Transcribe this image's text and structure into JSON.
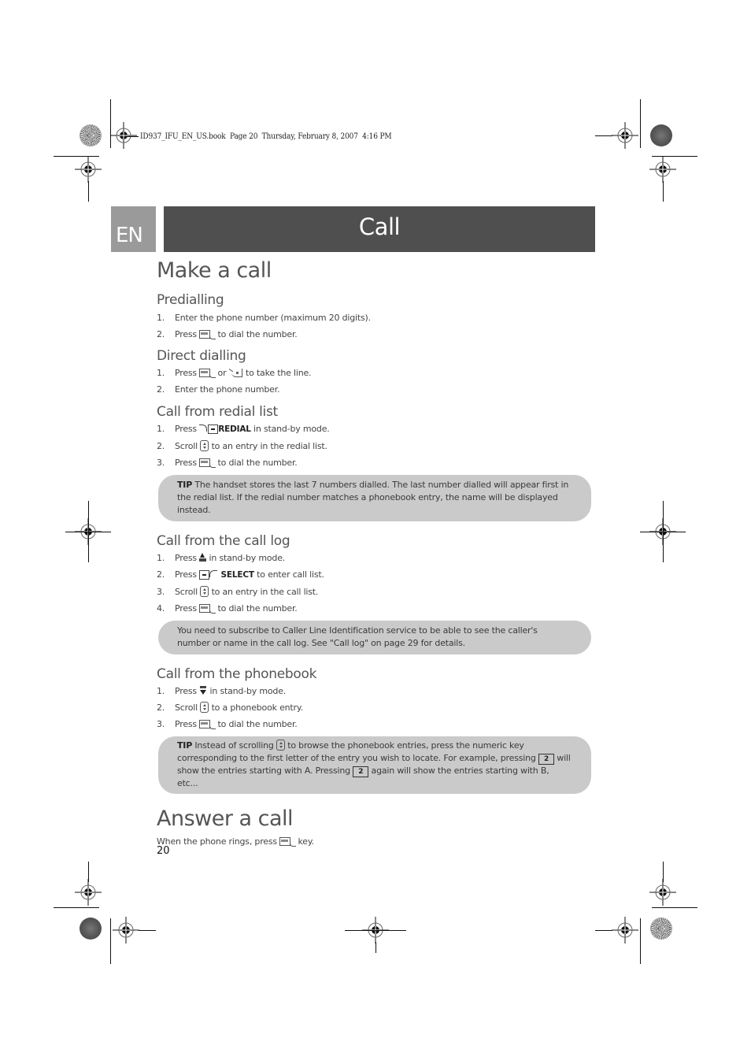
{
  "slug": "ID937_IFU_EN_US.book  Page 20  Thursday, February 8, 2007  4:16 PM",
  "header": {
    "language_tab": "EN",
    "chapter_title": "Call"
  },
  "sections": {
    "make_a_call": {
      "title": "Make a call",
      "predialling": {
        "title": "Predialling",
        "steps": [
          {
            "num": "1.",
            "text": "Enter the phone number (maximum 20 digits)."
          },
          {
            "num": "2.",
            "pre": "Press",
            "icon": "talk-key-icon",
            "post": "to dial the number."
          }
        ]
      },
      "direct_dialling": {
        "title": "Direct dialling",
        "steps": [
          {
            "num": "1.",
            "pre": "Press",
            "icon": "talk-key-icon",
            "mid": "or",
            "icon2": "speaker-key-icon",
            "post": "to take the line."
          },
          {
            "num": "2.",
            "text": "Enter the phone number."
          }
        ]
      },
      "redial": {
        "title": "Call from redial list",
        "steps": [
          {
            "num": "1.",
            "pre": "Press",
            "icon": "right-softkey-icon",
            "key": "REDIAL",
            "post": "in stand-by mode."
          },
          {
            "num": "2.",
            "pre": "Scroll",
            "icon": "scroll-key-icon",
            "post": "to an entry in the redial list."
          },
          {
            "num": "3.",
            "pre": "Press",
            "icon": "talk-key-icon",
            "post": "to dial the number."
          }
        ],
        "tip": {
          "label": "TIP",
          "text": "The handset stores the last 7 numbers dialled. The last number dialled will appear first in the redial list. If the redial number matches a phonebook entry, the name will be displayed instead."
        }
      },
      "call_log": {
        "title": "Call from the call log",
        "steps": [
          {
            "num": "1.",
            "pre": "Press",
            "icon": "call-log-up-key-icon",
            "post": "in stand-by mode."
          },
          {
            "num": "2.",
            "pre": "Press",
            "icon": "left-softkey-icon",
            "key": "SELECT",
            "post": "to enter call list."
          },
          {
            "num": "3.",
            "pre": "Scroll",
            "icon": "scroll-key-icon",
            "post": "to an entry in the call list."
          },
          {
            "num": "4.",
            "pre": "Press",
            "icon": "talk-key-icon",
            "post": "to dial the number."
          }
        ],
        "note": "You need to subscribe to Caller Line Identification service to be able to see the caller's number or name in the call log. See \"Call log\" on page 29 for details."
      },
      "phonebook": {
        "title": "Call from the phonebook",
        "steps": [
          {
            "num": "1.",
            "pre": "Press",
            "icon": "phonebook-down-key-icon",
            "post": "in stand-by mode."
          },
          {
            "num": "2.",
            "pre": "Scroll",
            "icon": "scroll-key-icon",
            "post": "to a phonebook entry."
          },
          {
            "num": "3.",
            "pre": "Press",
            "icon": "talk-key-icon",
            "post": "to dial the number."
          }
        ],
        "tip": {
          "label": "TIP",
          "part1": "Instead of scrolling",
          "part2": "to browse the phonebook entries, press the numeric key corresponding to the first letter of the entry you wish to locate. For example, pressing",
          "part3": "will show the entries starting with A. Pressing",
          "part4": "again will show the entries starting with B, etc...",
          "key_label": "2"
        }
      }
    },
    "answer_a_call": {
      "title": "Answer a call",
      "pre": "When the phone rings, press",
      "post": "key."
    }
  },
  "page_number": "20"
}
